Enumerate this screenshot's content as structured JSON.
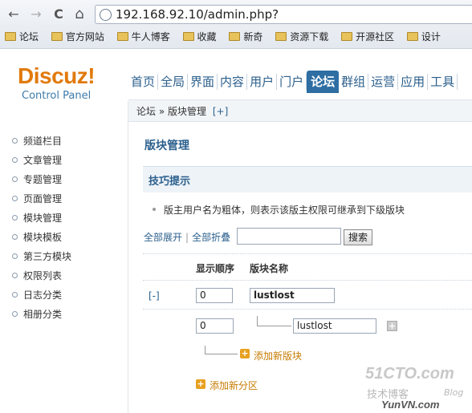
{
  "browser": {
    "url": "192.168.92.10/admin.php?",
    "back_glyph": "←",
    "forward_glyph": "→",
    "reload_glyph": "C",
    "home_glyph": "⌂",
    "bookmarks": [
      "论坛",
      "官方网站",
      "牛人博客",
      "收藏",
      "新奇",
      "资源下载",
      "开源社区",
      "设计"
    ]
  },
  "header": {
    "logo": "Discuz!",
    "logo_sub": "Control Panel",
    "tabs": [
      "首页",
      "全局",
      "界面",
      "内容",
      "用户",
      "门户",
      "论坛",
      "群组",
      "运营",
      "应用",
      "工具"
    ],
    "active_tab": "论坛"
  },
  "breadcrumb": {
    "root": "论坛",
    "separator": "»",
    "current": "版块管理",
    "add": "[+]"
  },
  "sidebar": {
    "items": [
      "频道栏目",
      "文章管理",
      "专题管理",
      "页面管理",
      "模块管理",
      "模块模板",
      "第三方模块",
      "权限列表",
      "日志分类",
      "相册分类"
    ]
  },
  "main": {
    "title": "版块管理",
    "tips_title": "技巧提示",
    "tip": "版主用户名为粗体，则表示该版主权限可继承到下级版块",
    "expand_all": "全部展开",
    "link_sep": "|",
    "collapse_all": "全部折叠",
    "search_value": "",
    "search_button": "搜索",
    "col_order": "显示顺序",
    "col_name": "版块名称",
    "toggle": "[-]",
    "rows": [
      {
        "order": "0",
        "name": "lustlost"
      },
      {
        "order": "0",
        "name": "lustlost"
      }
    ],
    "plus_glyph": "+",
    "add_board": "添加新版块",
    "add_section": "添加新分区"
  },
  "watermark": {
    "line1": "51CTO.com",
    "line2": "技术博客",
    "line3": "Blog",
    "line4": "YunVN.com"
  },
  "colors": {
    "accent": "#2e6ea3",
    "logo": "#e17a0c",
    "add": "#e8a020"
  }
}
